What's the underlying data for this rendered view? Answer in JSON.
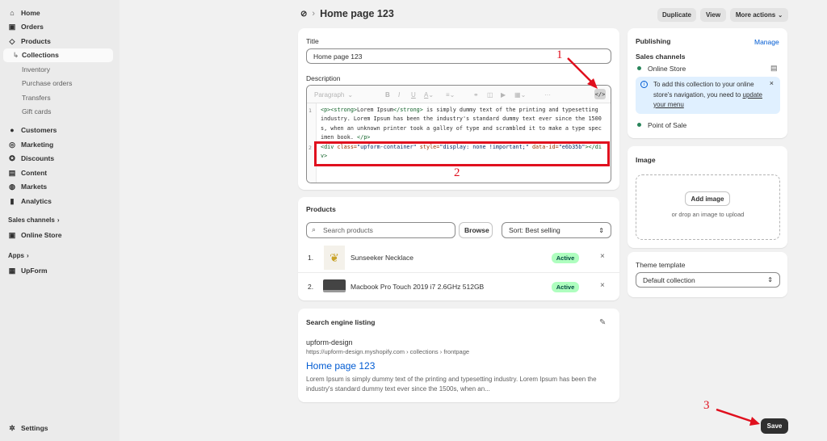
{
  "sidebar": {
    "main": [
      {
        "label": "Home",
        "icon": "home-icon",
        "glyph": "⌂"
      },
      {
        "label": "Orders",
        "icon": "orders-icon",
        "glyph": "▣"
      },
      {
        "label": "Products",
        "icon": "tag-icon",
        "glyph": "◇"
      }
    ],
    "product_subs": [
      {
        "label": "Collections"
      },
      {
        "label": "Inventory"
      },
      {
        "label": "Purchase orders"
      },
      {
        "label": "Transfers"
      },
      {
        "label": "Gift cards"
      }
    ],
    "main2": [
      {
        "label": "Customers",
        "icon": "person-icon",
        "glyph": "●"
      },
      {
        "label": "Marketing",
        "icon": "target-icon",
        "glyph": "◎"
      },
      {
        "label": "Discounts",
        "icon": "discount-icon",
        "glyph": "✪"
      },
      {
        "label": "Content",
        "icon": "content-icon",
        "glyph": "▤"
      },
      {
        "label": "Markets",
        "icon": "globe-icon",
        "glyph": "◍"
      },
      {
        "label": "Analytics",
        "icon": "chart-icon",
        "glyph": "▮"
      }
    ],
    "sales_channels_label": "Sales channels",
    "online_store": "Online Store",
    "apps_label": "Apps",
    "upform": "UpForm",
    "settings": "Settings",
    "chevron": "›"
  },
  "header": {
    "breadcrumb_sep": "›",
    "title": "Home page 123",
    "duplicate": "Duplicate",
    "view": "View",
    "more_actions": "More actions"
  },
  "form": {
    "title_label": "Title",
    "title_value": "Home page 123",
    "description_label": "Description",
    "toolbar": {
      "paragraph": "Paragraph",
      "bold": "B",
      "italic": "I",
      "underline": "U",
      "color": "A",
      "more": "···",
      "code": "</>"
    },
    "code_lines": {
      "l1_num": "1",
      "l2_num": "2",
      "l1_open_tags": "<p><strong>",
      "l1_strong_text": "Lorem Ipsum",
      "l1_close_strong": "</strong>",
      "l1_text": " is simply dummy text of the printing and typesetting industry. Lorem Ipsum has been the industry's standard dummy text ever since the 1500s, when an unknown printer took a galley of type and scrambled it to make a type specimen book. ",
      "l1_close_p": "</p>",
      "l2_open": "<div ",
      "l2_attr1": "class=",
      "l2_val1": "\"upform-container\"",
      "l2_attr2": " style=",
      "l2_val2": "\"display: none !important;\"",
      "l2_attr3": " data-id=",
      "l2_val3": "\"e6b35b\"",
      "l2_close": "></div>"
    }
  },
  "annotations": {
    "n1": "1",
    "n2": "2",
    "n3": "3"
  },
  "products": {
    "heading": "Products",
    "search_placeholder": "Search products",
    "browse": "Browse",
    "sort": "Sort: Best selling",
    "items": [
      {
        "index": "1.",
        "name": "Sunseeker Necklace",
        "status": "Active"
      },
      {
        "index": "2.",
        "name": "Macbook Pro Touch 2019 i7 2.6GHz 512GB",
        "status": "Active"
      }
    ]
  },
  "seo": {
    "heading": "Search engine listing",
    "site": "upform-design",
    "url": "https://upform-design.myshopify.com › collections › frontpage",
    "title": "Home page 123",
    "description": "Lorem Ipsum is simply dummy text of the printing and typesetting industry. Lorem Ipsum has been the industry's standard dummy text ever since the 1500s, when an..."
  },
  "publishing": {
    "heading": "Publishing",
    "manage": "Manage",
    "sales_channels": "Sales channels",
    "online_store": "Online Store",
    "info_text_1": "To add this collection to your online store's navigation, you need to ",
    "info_link": "update your menu",
    "pos": "Point of Sale"
  },
  "image": {
    "heading": "Image",
    "add": "Add image",
    "drop": "or drop an image to upload"
  },
  "theme": {
    "heading": "Theme template",
    "value": "Default collection"
  },
  "save": "Save",
  "colors": {
    "accent": "#005bd3",
    "annotation": "#e0101e",
    "active_bg": "#affebf"
  }
}
